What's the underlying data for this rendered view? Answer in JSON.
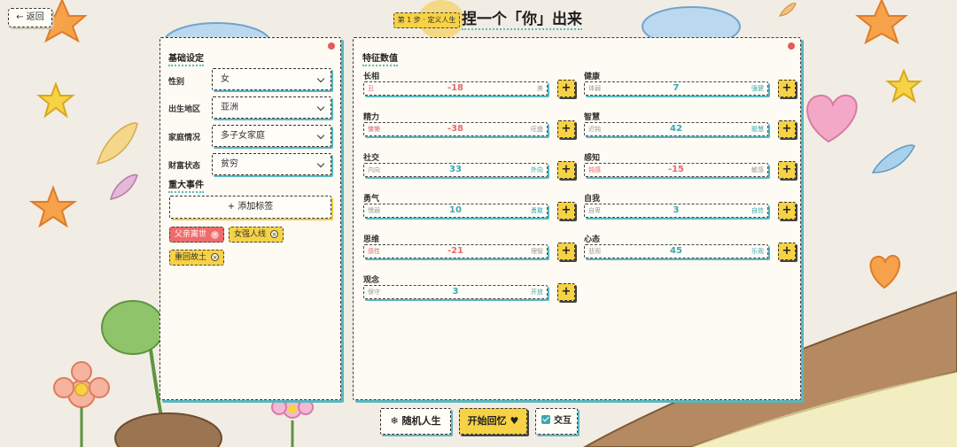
{
  "topbar": {
    "back_label": "← 返回",
    "step_tag": "第 1 步 · 定义人生",
    "title": "捏一个「你」出来"
  },
  "basic": {
    "title": "基础设定",
    "fields": [
      {
        "label": "性别",
        "value": "女"
      },
      {
        "label": "出生地区",
        "value": "亚洲"
      },
      {
        "label": "家庭情况",
        "value": "多子女家庭"
      },
      {
        "label": "财富状态",
        "value": "贫穷"
      }
    ]
  },
  "events": {
    "title": "重大事件",
    "add_label": "+ 添加标签",
    "tags": [
      {
        "label": "父亲离世",
        "close": "×",
        "color": "red"
      },
      {
        "label": "女强人线",
        "close": "×",
        "color": "yellow"
      },
      {
        "label": "重回故土",
        "close": "×",
        "color": "yellow"
      }
    ]
  },
  "traits": {
    "title": "特征数值",
    "plus_label": "+",
    "items": [
      {
        "name": "长相",
        "low": "丑",
        "high": "美",
        "value": "-18"
      },
      {
        "name": "健康",
        "low": "体弱",
        "high": "强健",
        "value": "7"
      },
      {
        "name": "精力",
        "low": "慵懒",
        "high": "旺盛",
        "value": "-38"
      },
      {
        "name": "智慧",
        "low": "迟钝",
        "high": "聪慧",
        "value": "42"
      },
      {
        "name": "社交",
        "low": "内向",
        "high": "外向",
        "value": "33"
      },
      {
        "name": "感知",
        "low": "钝感",
        "high": "敏感",
        "value": "-15"
      },
      {
        "name": "勇气",
        "low": "懦弱",
        "high": "勇敢",
        "value": "10"
      },
      {
        "name": "自我",
        "low": "自卑",
        "high": "自信",
        "value": "3"
      },
      {
        "name": "思维",
        "low": "感性",
        "high": "理智",
        "value": "-21"
      },
      {
        "name": "心态",
        "low": "悲观",
        "high": "乐观",
        "value": "45"
      },
      {
        "name": "观念",
        "low": "保守",
        "high": "开放",
        "value": "3"
      }
    ]
  },
  "bottom": {
    "random_label": "❄ 随机人生",
    "start_label": "开始回忆 ♥",
    "interact_label": "交互",
    "interact_checked": true
  },
  "colors": {
    "accent_yellow": "#f6d244",
    "accent_teal": "#3ba7b0",
    "negative_red": "#e46b6b"
  }
}
